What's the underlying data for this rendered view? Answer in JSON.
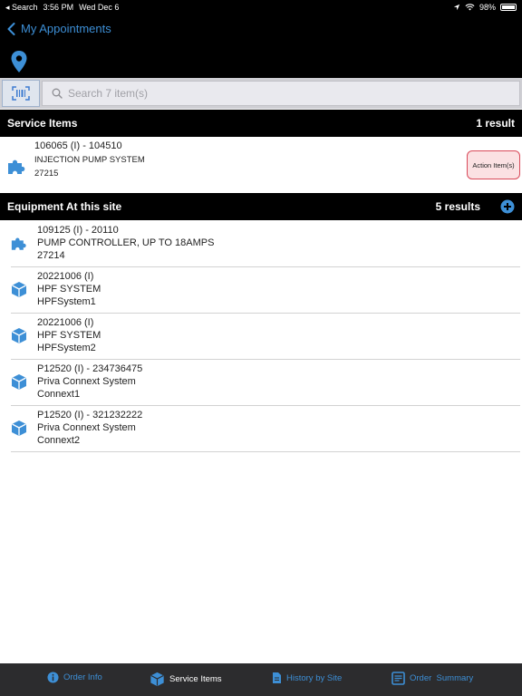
{
  "status_bar": {
    "back_app": "◂ Search",
    "time": "3:56 PM",
    "date": "Wed Dec 6",
    "battery": "98%"
  },
  "nav": {
    "back_label": "My Appointments"
  },
  "search": {
    "placeholder": "Search 7 item(s)",
    "value": ""
  },
  "service_section": {
    "title": "Service Items",
    "count": "1 result"
  },
  "service_item": {
    "line1": "106065 (I) - 104510",
    "line2": "INJECTION PUMP SYSTEM",
    "line3": "27215",
    "action_label": "Action Item(s)",
    "icon": "puzzle-icon"
  },
  "equipment_section": {
    "title": "Equipment At this site",
    "count": "5 results"
  },
  "equipment": [
    {
      "line1": "109125 (I) - 20110",
      "line2": "PUMP CONTROLLER, UP TO 18AMPS",
      "line3": "27214",
      "icon": "puzzle-icon"
    },
    {
      "line1": "20221006 (I)",
      "line2": "HPF SYSTEM",
      "line3": "HPFSystem1",
      "icon": "cube-icon"
    },
    {
      "line1": "20221006 (I)",
      "line2": "HPF SYSTEM",
      "line3": "HPFSystem2",
      "icon": "cube-icon"
    },
    {
      "line1": "P12520 (I) - 234736475",
      "line2": "Priva Connext System",
      "line3": "Connext1",
      "icon": "cube-icon"
    },
    {
      "line1": "P12520 (I) - 321232222",
      "line2": "Priva Connext System",
      "line3": "Connext2",
      "icon": "cube-icon"
    }
  ],
  "tabs": [
    {
      "label": "Order Info",
      "icon": "info-icon",
      "active": false
    },
    {
      "label": "Service Items",
      "icon": "cube-icon",
      "active": true
    },
    {
      "label": "History by Site",
      "icon": "document-icon",
      "active": false
    },
    {
      "label": "Order  Summary",
      "icon": "summary-icon",
      "active": false
    }
  ],
  "colors": {
    "accent": "#3d8fd6",
    "header_bg": "#000000",
    "tab_bar_bg": "#2c2c2e",
    "action_bg": "#fbe1e3",
    "action_border": "#d94a5a"
  }
}
